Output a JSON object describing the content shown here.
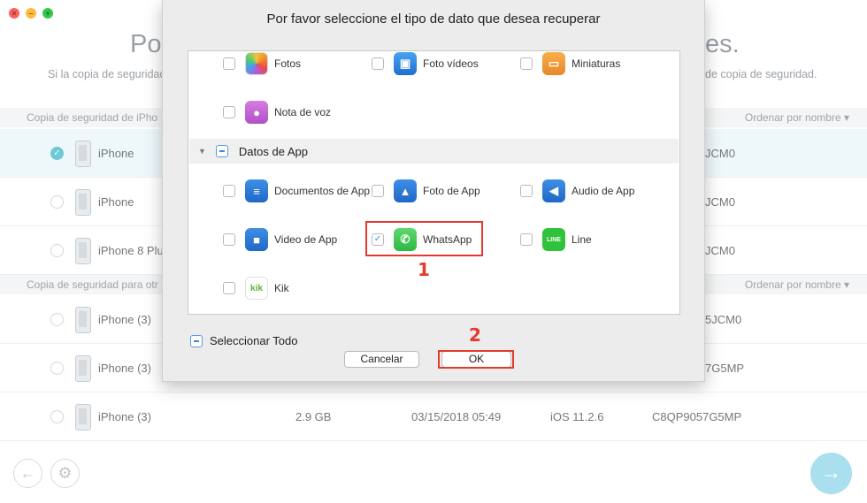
{
  "window": {
    "controls": [
      "close",
      "minimize",
      "zoom"
    ]
  },
  "background": {
    "title_left": "Por",
    "title_right": "es.",
    "subtitle_left": "Si la copia de seguridad",
    "subtitle_right": "de copia de seguridad.",
    "section1": {
      "label": "Copia de seguridad de iPho",
      "sort": "Ordenar por nombre ▾"
    },
    "section2": {
      "label": "Copia de seguridad para otr",
      "sort": "Ordenar por nombre ▾"
    },
    "rows": [
      {
        "name": "iPhone",
        "id": "JCM0",
        "selected": true
      },
      {
        "name": "iPhone",
        "id": "JCM0",
        "selected": false
      },
      {
        "name": "iPhone 8 Plu",
        "id": "JCM0",
        "selected": false
      },
      {
        "name": "iPhone (3)",
        "id": "5JCM0",
        "selected": false
      },
      {
        "name": "iPhone (3)",
        "id": "7G5MP",
        "selected": false
      },
      {
        "name": "iPhone (3)",
        "size": "2.9 GB",
        "date": "03/15/2018 05:49",
        "ios": "iOS 11.2.6",
        "id": "C8QP9057G5MP",
        "selected": false
      }
    ]
  },
  "dialog": {
    "title": "Por favor seleccione el tipo de dato que desea recuperar",
    "items_top": [
      {
        "label": "Fotos",
        "icon": "photos-icon",
        "checked": false
      },
      {
        "label": "Foto vídeos",
        "icon": "photo-video-icon",
        "checked": false
      },
      {
        "label": "Miniaturas",
        "icon": "thumbnails-icon",
        "checked": false
      },
      {
        "label": "Nota de voz",
        "icon": "voice-memo-icon",
        "checked": false
      }
    ],
    "group": {
      "label": "Datos de App",
      "state": "mixed"
    },
    "app_items": [
      {
        "label": "Documentos de App",
        "icon": "documents-icon",
        "checked": false
      },
      {
        "label": "Foto de App",
        "icon": "app-photo-icon",
        "checked": false
      },
      {
        "label": "Audio de App",
        "icon": "audio-icon",
        "checked": false
      },
      {
        "label": "Video de App",
        "icon": "video-icon",
        "checked": false
      },
      {
        "label": "WhatsApp",
        "icon": "whatsapp-icon",
        "checked": true
      },
      {
        "label": "Line",
        "icon": "line-icon",
        "checked": false
      },
      {
        "label": "Kik",
        "icon": "kik-icon",
        "checked": false
      }
    ],
    "select_all": "Seleccionar Todo",
    "cancel": "Cancelar",
    "ok": "OK"
  },
  "annotations": {
    "step1": "1",
    "step2": "2"
  },
  "colors": {
    "accent": "#6fc8d5",
    "highlight": "#e43b2c",
    "next": "#a9dfee"
  }
}
